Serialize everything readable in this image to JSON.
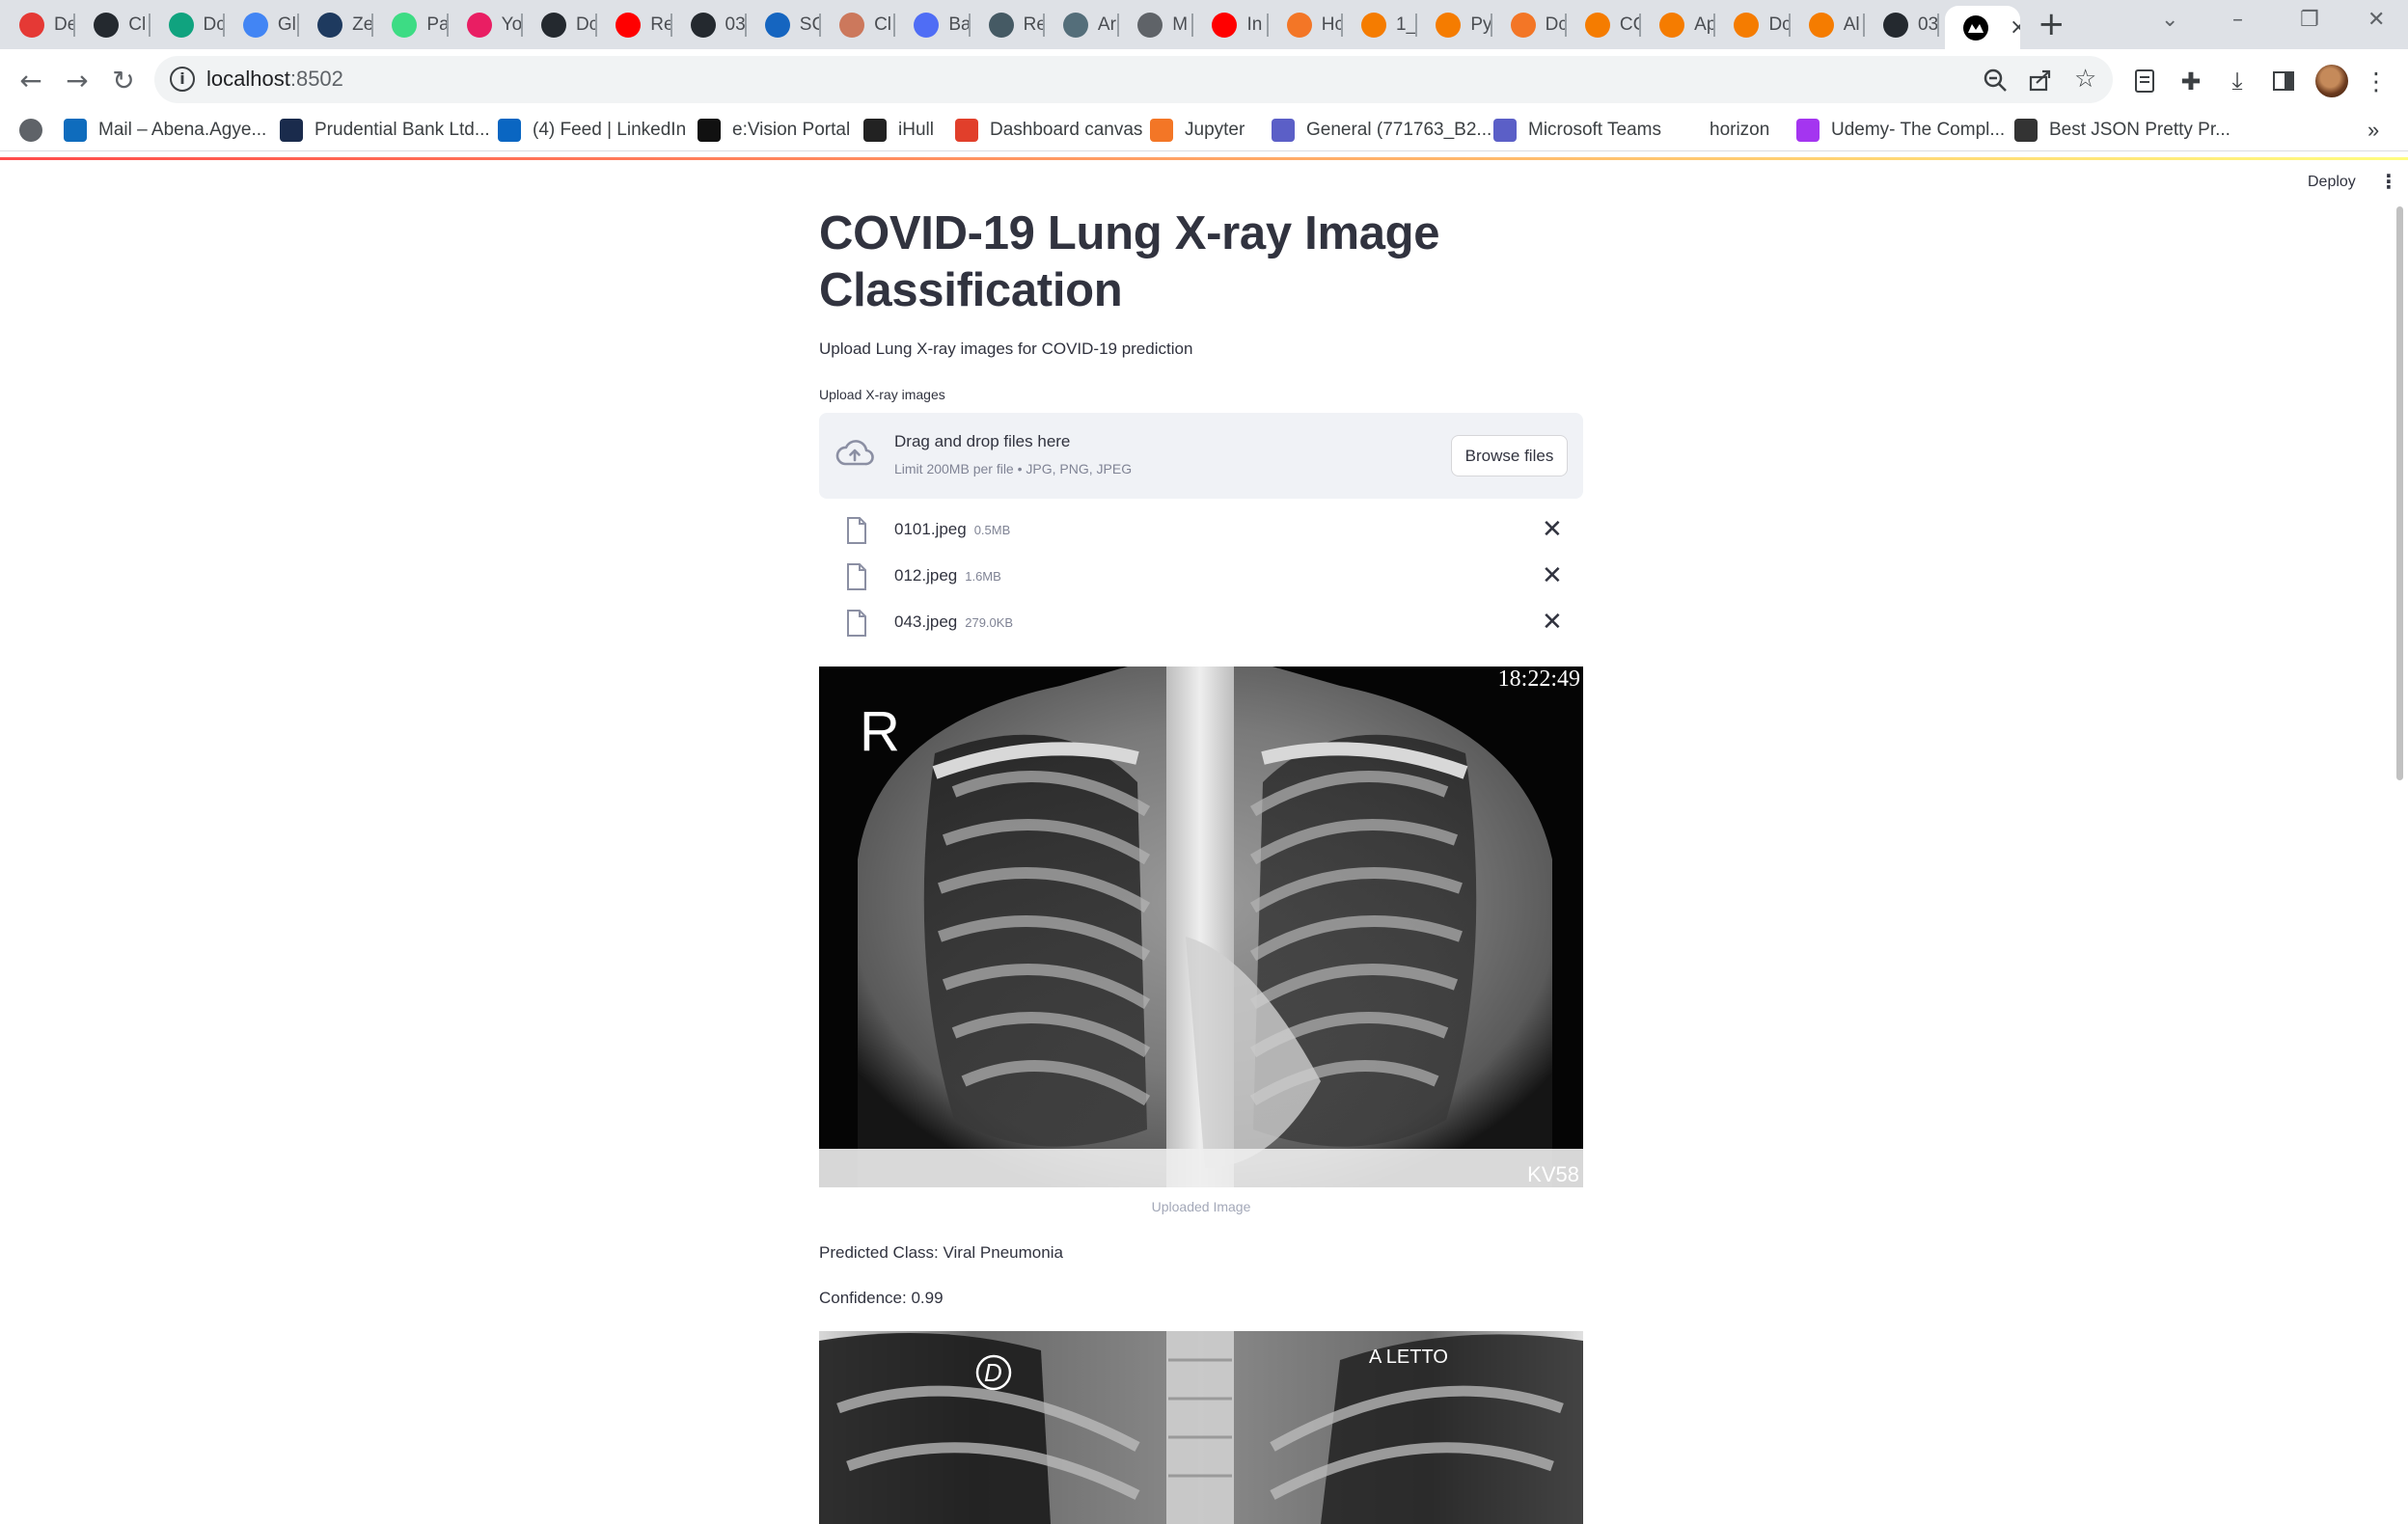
{
  "browser": {
    "tabs": [
      {
        "label": "De",
        "icon": "red-pinwheel-icon",
        "color": "#e53935"
      },
      {
        "label": "Cl",
        "icon": "github-icon",
        "color": "#24292f"
      },
      {
        "label": "Dc",
        "icon": "chatgpt-icon",
        "color": "#10a37f"
      },
      {
        "label": "Gl",
        "icon": "google-icon",
        "color": "#4285f4"
      },
      {
        "label": "Ze",
        "icon": "book-icon",
        "color": "#1e3a5f"
      },
      {
        "label": "Pa",
        "icon": "android-icon",
        "color": "#3ddc84"
      },
      {
        "label": "Yo",
        "icon": "download-icon",
        "color": "#e91e63"
      },
      {
        "label": "Dc",
        "icon": "github-icon",
        "color": "#24292f"
      },
      {
        "label": "Re",
        "icon": "youtube-icon",
        "color": "#ff0000"
      },
      {
        "label": "03",
        "icon": "github-icon",
        "color": "#24292f"
      },
      {
        "label": "SC",
        "icon": "sql-icon",
        "color": "#1565c0"
      },
      {
        "label": "Cl",
        "icon": "anthropic-icon",
        "color": "#cc785c"
      },
      {
        "label": "Ba",
        "icon": "sparkle-icon",
        "color": "#4f6df5"
      },
      {
        "label": "Re",
        "icon": "site-icon",
        "color": "#455a64"
      },
      {
        "label": "Ar",
        "icon": "site-icon",
        "color": "#546e7a"
      },
      {
        "label": "M",
        "icon": "globe-icon",
        "color": "#5f6368"
      },
      {
        "label": "In",
        "icon": "youtube-icon",
        "color": "#ff0000"
      },
      {
        "label": "Hc",
        "icon": "jupyter-icon",
        "color": "#f37626"
      },
      {
        "label": "1_",
        "icon": "notebook-icon",
        "color": "#f57c00"
      },
      {
        "label": "Py",
        "icon": "notebook-icon",
        "color": "#f57c00"
      },
      {
        "label": "Dc",
        "icon": "jupyter-icon",
        "color": "#f37626"
      },
      {
        "label": "CC",
        "icon": "notebook-icon",
        "color": "#f57c00"
      },
      {
        "label": "Ap",
        "icon": "notebook-icon",
        "color": "#f57c00"
      },
      {
        "label": "Dc",
        "icon": "notebook-icon",
        "color": "#f57c00"
      },
      {
        "label": "Al",
        "icon": "notebook-icon",
        "color": "#f57c00"
      },
      {
        "label": "03",
        "icon": "github-icon",
        "color": "#24292f"
      }
    ],
    "active_tab": {
      "label": "",
      "icon": "streamlit-icon",
      "color": "#000000"
    },
    "url_host": "localhost",
    "url_port": ":8502",
    "bookmarks": [
      {
        "label": "",
        "icon": "globe-icon",
        "color": "#5f6368"
      },
      {
        "label": "Mail – Abena.Agye...",
        "icon": "outlook-icon",
        "color": "#0f6cbd"
      },
      {
        "label": "Prudential Bank Ltd...",
        "icon": "bank-icon",
        "color": "#1a2b4c"
      },
      {
        "label": "(4) Feed | LinkedIn",
        "icon": "linkedin-icon",
        "color": "#0a66c2"
      },
      {
        "label": "e:Vision Portal",
        "icon": "evision-icon",
        "color": "#111111"
      },
      {
        "label": "iHull",
        "icon": "hull-icon",
        "color": "#222222"
      },
      {
        "label": "Dashboard canvas",
        "icon": "canvas-icon",
        "color": "#e13f2b"
      },
      {
        "label": "Jupyter",
        "icon": "jupyter-icon",
        "color": "#f37626"
      },
      {
        "label": "General (771763_B2...",
        "icon": "teams-icon",
        "color": "#5b5fc7"
      },
      {
        "label": "Microsoft Teams",
        "icon": "teams-icon",
        "color": "#5b5fc7"
      },
      {
        "label": "horizon",
        "icon": "",
        "color": "#ffffff"
      },
      {
        "label": "Udemy- The Compl...",
        "icon": "udemy-icon",
        "color": "#a435f0"
      },
      {
        "label": "Best JSON Pretty Pr...",
        "icon": "jf-icon",
        "color": "#333333"
      }
    ],
    "more_bookmarks": "»"
  },
  "app": {
    "deploy_label": "Deploy",
    "title": "COVID-19 Lung X-ray Image Classification",
    "subtitle": "Upload Lung X-ray images for COVID-19 prediction",
    "uploader": {
      "label": "Upload X-ray images",
      "drag_text": "Drag and drop files here",
      "limit_text": "Limit 200MB per file • JPG, PNG, JPEG",
      "browse_label": "Browse files"
    },
    "files": [
      {
        "name": "0101.jpeg",
        "size": "0.5MB"
      },
      {
        "name": "012.jpeg",
        "size": "1.6MB"
      },
      {
        "name": "043.jpeg",
        "size": "279.0KB"
      }
    ],
    "results": [
      {
        "image_overlay_left": "R",
        "image_overlay_time": "18:22:49",
        "image_overlay_bottom": "KV58",
        "caption": "Uploaded Image",
        "predicted": "Predicted Class: Viral Pneumonia",
        "confidence": "Confidence: 0.99"
      },
      {
        "image_overlay_left": "D",
        "image_overlay_right": "A LETTO"
      }
    ]
  }
}
